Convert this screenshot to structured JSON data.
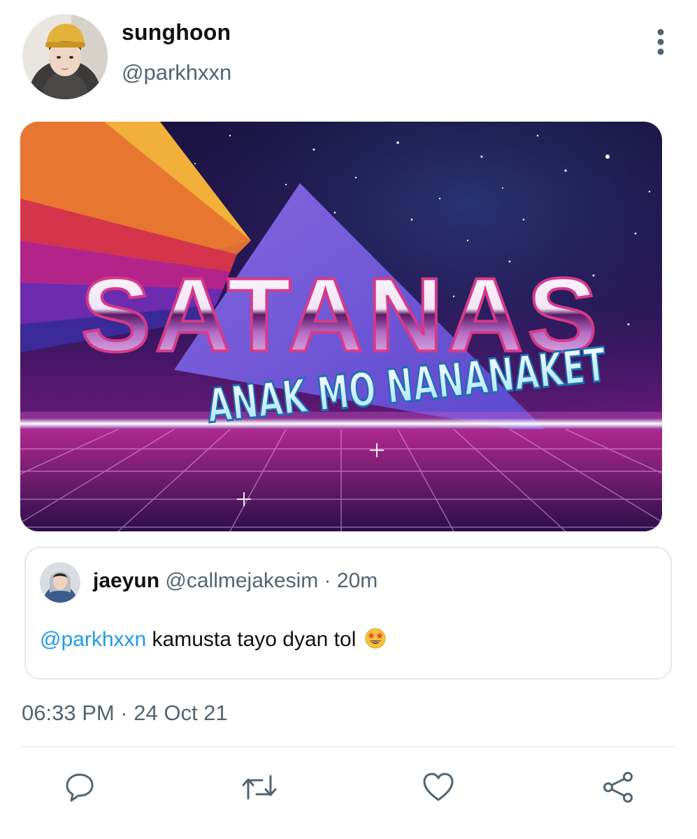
{
  "tweet": {
    "author_name": "sunghoon",
    "author_handle": "@parkhxxn",
    "media": {
      "title": "SATANAS",
      "subtitle": "ANAK MO NANANAKET"
    },
    "timestamp": "06:33 PM · 24 Oct 21"
  },
  "quote": {
    "name": "jaeyun",
    "meta": "@callmejakesim · 20m",
    "mention": "@parkhxxn",
    "text": "kamusta tayo dyan tol",
    "emoji": "star-struck-emoji"
  },
  "actions": [
    {
      "icon": "reply-icon"
    },
    {
      "icon": "retweet-icon"
    },
    {
      "icon": "heart-icon"
    },
    {
      "icon": "share-icon"
    }
  ],
  "colors": {
    "link": "#1d9bf0",
    "secondary_text": "#536471",
    "border": "#e4e8eb"
  }
}
